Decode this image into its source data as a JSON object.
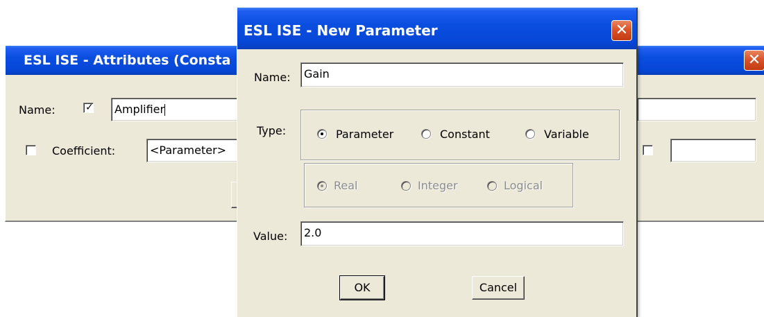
{
  "back_window": {
    "title": "ESL ISE - Attributes (Consta",
    "name_label": "Name:",
    "name_checked": true,
    "name_value": "Amplifier",
    "coefficient_label": "Coefficient:",
    "coefficient_checked": false,
    "coefficient_value": "<Parameter>"
  },
  "dialog": {
    "title": "ESL ISE - New Parameter",
    "name_label": "Name:",
    "name_value": "Gain",
    "type_label": "Type:",
    "type_options": [
      "Parameter",
      "Constant",
      "Variable"
    ],
    "type_selected": "Parameter",
    "datatype_options": [
      "Real",
      "Integer",
      "Logical"
    ],
    "datatype_selected": "Real",
    "value_label": "Value:",
    "value_value": "2.0",
    "ok_label": "OK",
    "cancel_label": "Cancel"
  },
  "colors": {
    "titlebar": "#0a4ee0",
    "window_face": "#ece9d8",
    "close_button": "#d9542a"
  }
}
